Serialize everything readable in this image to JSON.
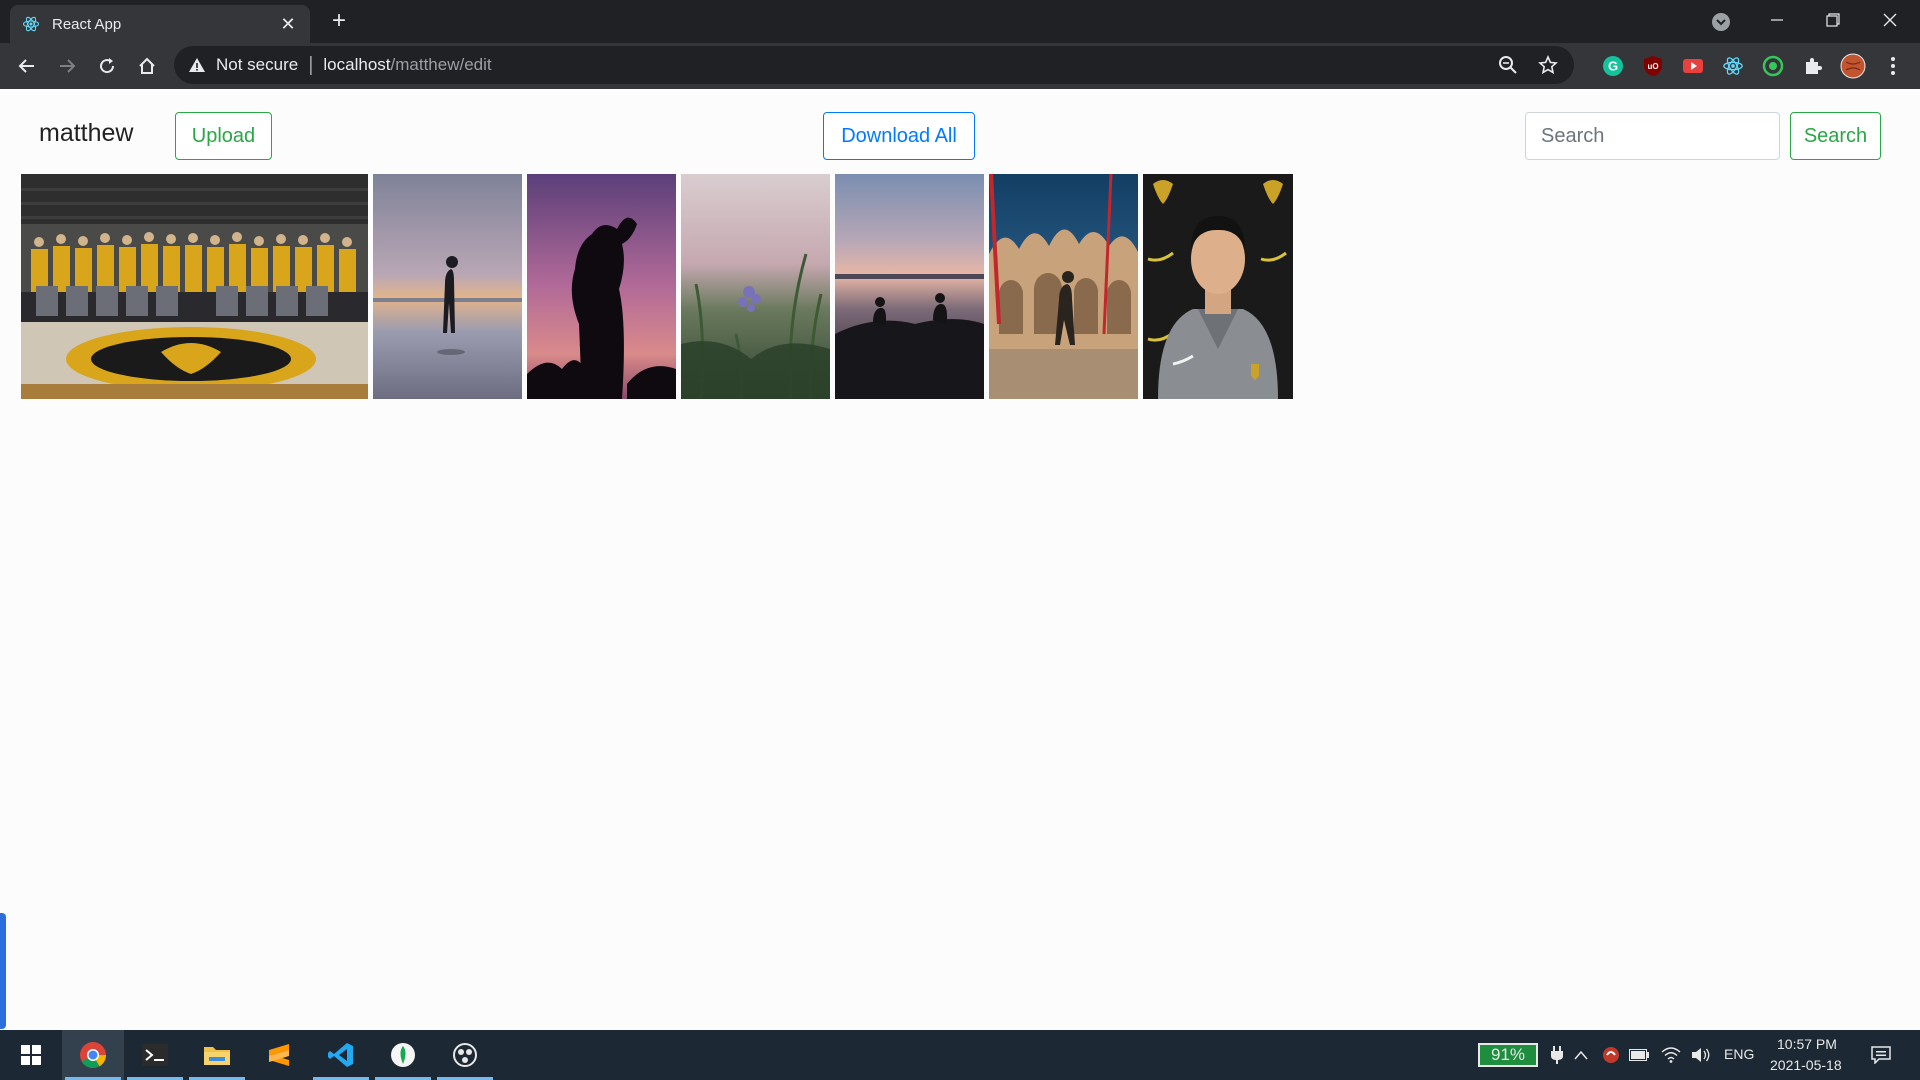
{
  "browser": {
    "tab_title": "React App",
    "security_label": "Not secure",
    "url_host": "localhost",
    "url_path": "/matthew/edit"
  },
  "app": {
    "username": "matthew",
    "upload_label": "Upload",
    "download_all_label": "Download All",
    "search_placeholder": "Search",
    "search_button_label": "Search"
  },
  "gallery": {
    "photos": [
      {
        "name": "team-photo",
        "colors": [
          "#c9a227",
          "#2b2b2b"
        ]
      },
      {
        "name": "beach-person",
        "colors": [
          "#8d8fa8",
          "#d8a97a"
        ]
      },
      {
        "name": "silhouette-sunset",
        "colors": [
          "#8c5e9a",
          "#120c14"
        ]
      },
      {
        "name": "lavender-field",
        "colors": [
          "#c9b7be",
          "#3f5a3a"
        ]
      },
      {
        "name": "lake-dusk",
        "colors": [
          "#b89fa6",
          "#1d1d22"
        ]
      },
      {
        "name": "piazza-building",
        "colors": [
          "#1e4f73",
          "#c8a77f"
        ]
      },
      {
        "name": "portrait-hoodie",
        "colors": [
          "#1b1b1b",
          "#8f9396"
        ]
      }
    ]
  },
  "taskbar": {
    "battery": "91%",
    "language": "ENG",
    "time": "10:57 PM",
    "date": "2021-05-18"
  },
  "colors": {
    "success": "#28a745",
    "primary": "#007bff"
  }
}
